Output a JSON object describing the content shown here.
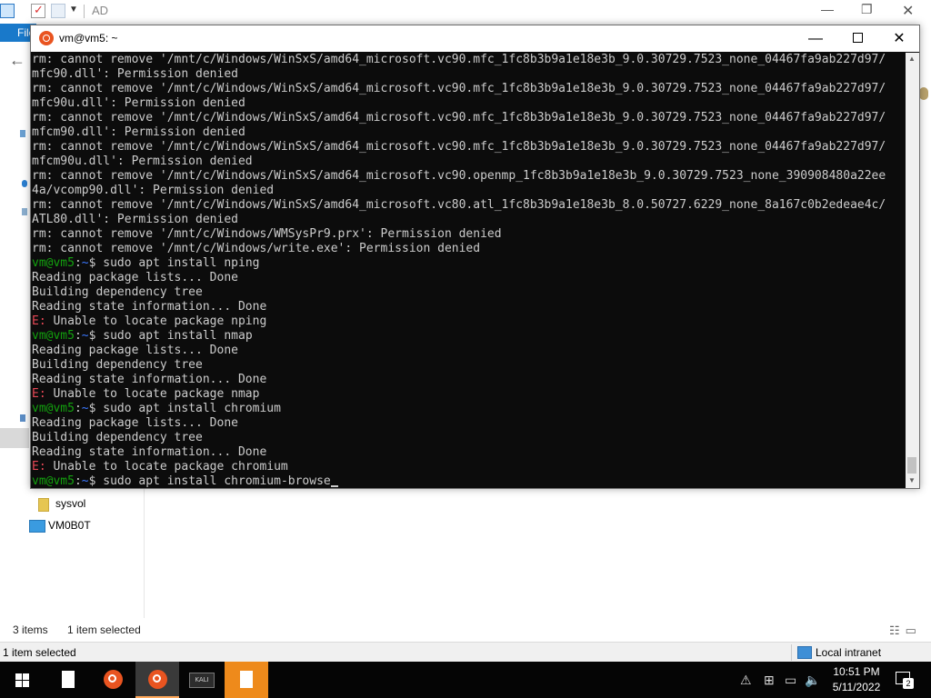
{
  "explorer": {
    "title": "AD",
    "file_tab": "File",
    "nav_items": [
      "sysvol",
      "VM0B0T"
    ],
    "status": {
      "items": "3 items",
      "selected": "1 item selected"
    },
    "bottom_status": {
      "left": "1 item selected",
      "zone": "Local intranet"
    }
  },
  "terminal": {
    "title": "vm@vm5: ~",
    "prompt": {
      "user": "vm@vm5",
      "sep": ":",
      "path": "~",
      "symbol": "$ "
    },
    "lines": [
      {
        "text": "rm: cannot remove '/mnt/c/Windows/WinSxS/amd64_microsoft.vc90.mfc_1fc8b3b9a1e18e3b_9.0.30729.7523_none_04467fa9ab227d97/"
      },
      {
        "text": "mfc90.dll': Permission denied"
      },
      {
        "text": "rm: cannot remove '/mnt/c/Windows/WinSxS/amd64_microsoft.vc90.mfc_1fc8b3b9a1e18e3b_9.0.30729.7523_none_04467fa9ab227d97/"
      },
      {
        "text": "mfc90u.dll': Permission denied"
      },
      {
        "text": "rm: cannot remove '/mnt/c/Windows/WinSxS/amd64_microsoft.vc90.mfc_1fc8b3b9a1e18e3b_9.0.30729.7523_none_04467fa9ab227d97/"
      },
      {
        "text": "mfcm90.dll': Permission denied"
      },
      {
        "text": "rm: cannot remove '/mnt/c/Windows/WinSxS/amd64_microsoft.vc90.mfc_1fc8b3b9a1e18e3b_9.0.30729.7523_none_04467fa9ab227d97/"
      },
      {
        "text": "mfcm90u.dll': Permission denied"
      },
      {
        "text": "rm: cannot remove '/mnt/c/Windows/WinSxS/amd64_microsoft.vc90.openmp_1fc8b3b9a1e18e3b_9.0.30729.7523_none_390908480a22ee"
      },
      {
        "text": "4a/vcomp90.dll': Permission denied"
      },
      {
        "text": "rm: cannot remove '/mnt/c/Windows/WinSxS/amd64_microsoft.vc80.atl_1fc8b3b9a1e18e3b_8.0.50727.6229_none_8a167c0b2edeae4c/"
      },
      {
        "text": "ATL80.dll': Permission denied"
      },
      {
        "text": "rm: cannot remove '/mnt/c/Windows/WMSysPr9.prx': Permission denied"
      },
      {
        "text": "rm: cannot remove '/mnt/c/Windows/write.exe': Permission denied"
      },
      {
        "kind": "prompt",
        "cmd": "sudo apt install nping"
      },
      {
        "text": "Reading package lists... Done"
      },
      {
        "text": "Building dependency tree"
      },
      {
        "text": "Reading state information... Done"
      },
      {
        "kind": "error",
        "tag": "E:",
        "text": " Unable to locate package nping"
      },
      {
        "kind": "prompt",
        "cmd": "sudo apt install nmap"
      },
      {
        "text": "Reading package lists... Done"
      },
      {
        "text": "Building dependency tree"
      },
      {
        "text": "Reading state information... Done"
      },
      {
        "kind": "error",
        "tag": "E:",
        "text": " Unable to locate package nmap"
      },
      {
        "kind": "prompt",
        "cmd": "sudo apt install chromium"
      },
      {
        "text": "Reading package lists... Done"
      },
      {
        "text": "Building dependency tree"
      },
      {
        "text": "Reading state information... Done"
      },
      {
        "kind": "error",
        "tag": "E:",
        "text": " Unable to locate package chromium"
      },
      {
        "kind": "prompt",
        "cmd": "sudo apt install chromium-browse",
        "cursor": true
      }
    ],
    "colors": {
      "background": "#0c0c0c",
      "text": "#cccccc",
      "user": "#13a10e",
      "path": "#3b78ff",
      "error": "#e74856"
    }
  },
  "taskbar": {
    "icons": [
      "windows-start-icon",
      "notepad-icon",
      "ubuntu-icon",
      "ubuntu-icon",
      "kali-icon",
      "notepad-icon"
    ],
    "kali_label": "KALI",
    "clock": {
      "time": "10:51 PM",
      "date": "5/11/2022"
    },
    "notification_count": "2"
  }
}
